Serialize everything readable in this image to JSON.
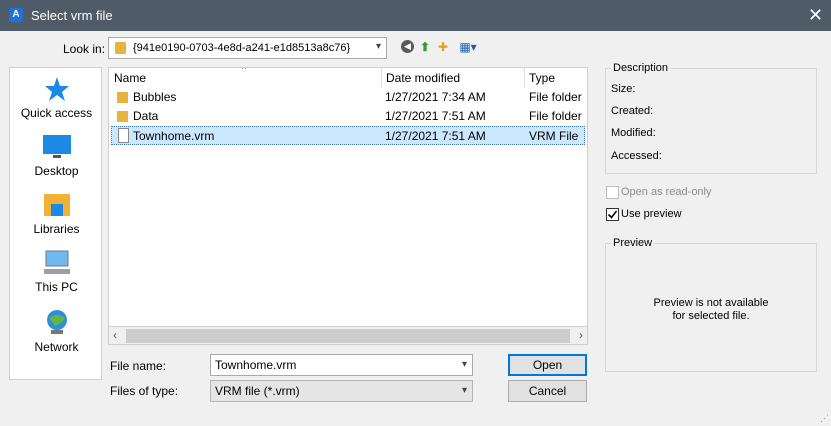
{
  "window": {
    "title": "Select vrm file",
    "close_glyph": "✕",
    "app_icon_glyph": "A"
  },
  "lookin": {
    "label": "Look in:",
    "value": "{941e0190-0703-4e8d-a241-e1d8513a8c76}"
  },
  "toolbar": {
    "icons": [
      "back-icon",
      "up-folder-icon",
      "new-folder-icon",
      "views-menu-icon"
    ]
  },
  "places": [
    {
      "label": "Quick access",
      "icon": "star-icon"
    },
    {
      "label": "Desktop",
      "icon": "desktop-icon"
    },
    {
      "label": "Libraries",
      "icon": "libraries-icon"
    },
    {
      "label": "This PC",
      "icon": "computer-icon"
    },
    {
      "label": "Network",
      "icon": "network-icon"
    }
  ],
  "files": {
    "columns": [
      "Name",
      "Date modified",
      "Type"
    ],
    "rows": [
      {
        "name": "Bubbles",
        "date": "1/27/2021 7:34 AM",
        "type": "File folder",
        "kind": "folder"
      },
      {
        "name": "Data",
        "date": "1/27/2021 7:51 AM",
        "type": "File folder",
        "kind": "folder"
      },
      {
        "name": "Townhome.vrm",
        "date": "1/27/2021 7:51 AM",
        "type": "VRM File",
        "kind": "file",
        "selected": true
      }
    ]
  },
  "filename": {
    "label": "File name:",
    "value": "Townhome.vrm"
  },
  "filetype": {
    "label": "Files of type:",
    "value": "VRM file (*.vrm)"
  },
  "buttons": {
    "open": "Open",
    "cancel": "Cancel"
  },
  "description": {
    "title": "Description",
    "fields": [
      "Size:",
      "Created:",
      "Modified:",
      "Accessed:"
    ]
  },
  "options": {
    "read_only": {
      "label": "Open as read-only",
      "checked": false,
      "enabled": false
    },
    "use_preview": {
      "label": "Use preview",
      "checked": true,
      "enabled": true
    }
  },
  "preview": {
    "title": "Preview",
    "message_line1": "Preview is not available",
    "message_line2": "for selected file."
  }
}
